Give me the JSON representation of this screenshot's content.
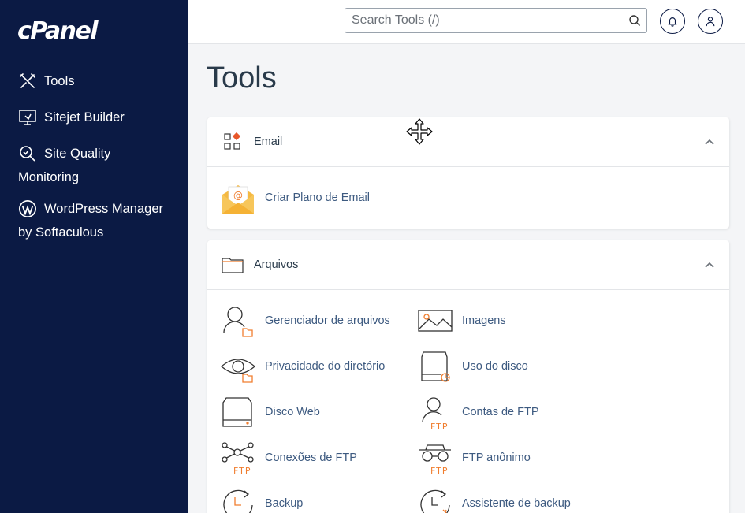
{
  "app": {
    "logo": "cPanel"
  },
  "sidebar": {
    "items": [
      {
        "label": "Tools",
        "icon": "tools-icon"
      },
      {
        "label": "Sitejet Builder",
        "icon": "monitor-icon"
      },
      {
        "label": "Site Quality",
        "label2": "Monitoring",
        "icon": "magnifier-check-icon"
      },
      {
        "label": "WordPress Manager",
        "label2": "by Softaculous",
        "icon": "wordpress-icon"
      }
    ]
  },
  "header": {
    "search_placeholder": "Search Tools (/)",
    "search_icon": "search-icon",
    "bell_icon": "bell-icon",
    "user_icon": "user-icon"
  },
  "main": {
    "title": "Tools",
    "sections": [
      {
        "title": "Email",
        "icon": "apps-grid-icon",
        "tools": [
          {
            "label": "Criar Plano de Email",
            "icon": "email-envelope-icon"
          }
        ]
      },
      {
        "title": "Arquivos",
        "icon": "folder-icon",
        "tools": [
          {
            "label": "Gerenciador de arquivos",
            "icon": "file-manager-icon"
          },
          {
            "label": "Imagens",
            "icon": "images-icon"
          },
          {
            "label": "Privacidade do diretório",
            "icon": "directory-privacy-icon"
          },
          {
            "label": "Uso do disco",
            "icon": "disk-usage-icon"
          },
          {
            "label": "Disco Web",
            "icon": "web-disk-icon"
          },
          {
            "label": "Contas de FTP",
            "icon": "ftp-accounts-icon"
          },
          {
            "label": "Conexões de FTP",
            "icon": "ftp-connections-icon"
          },
          {
            "label": "FTP anônimo",
            "icon": "anonymous-ftp-icon"
          },
          {
            "label": "Backup",
            "icon": "backup-icon"
          },
          {
            "label": "Assistente de backup",
            "icon": "backup-wizard-icon"
          }
        ]
      }
    ],
    "ftp_tag": "FTP"
  },
  "colors": {
    "sidebar_bg": "#0b1a44",
    "accent": "#f07d2e",
    "link": "#3d5a80"
  }
}
